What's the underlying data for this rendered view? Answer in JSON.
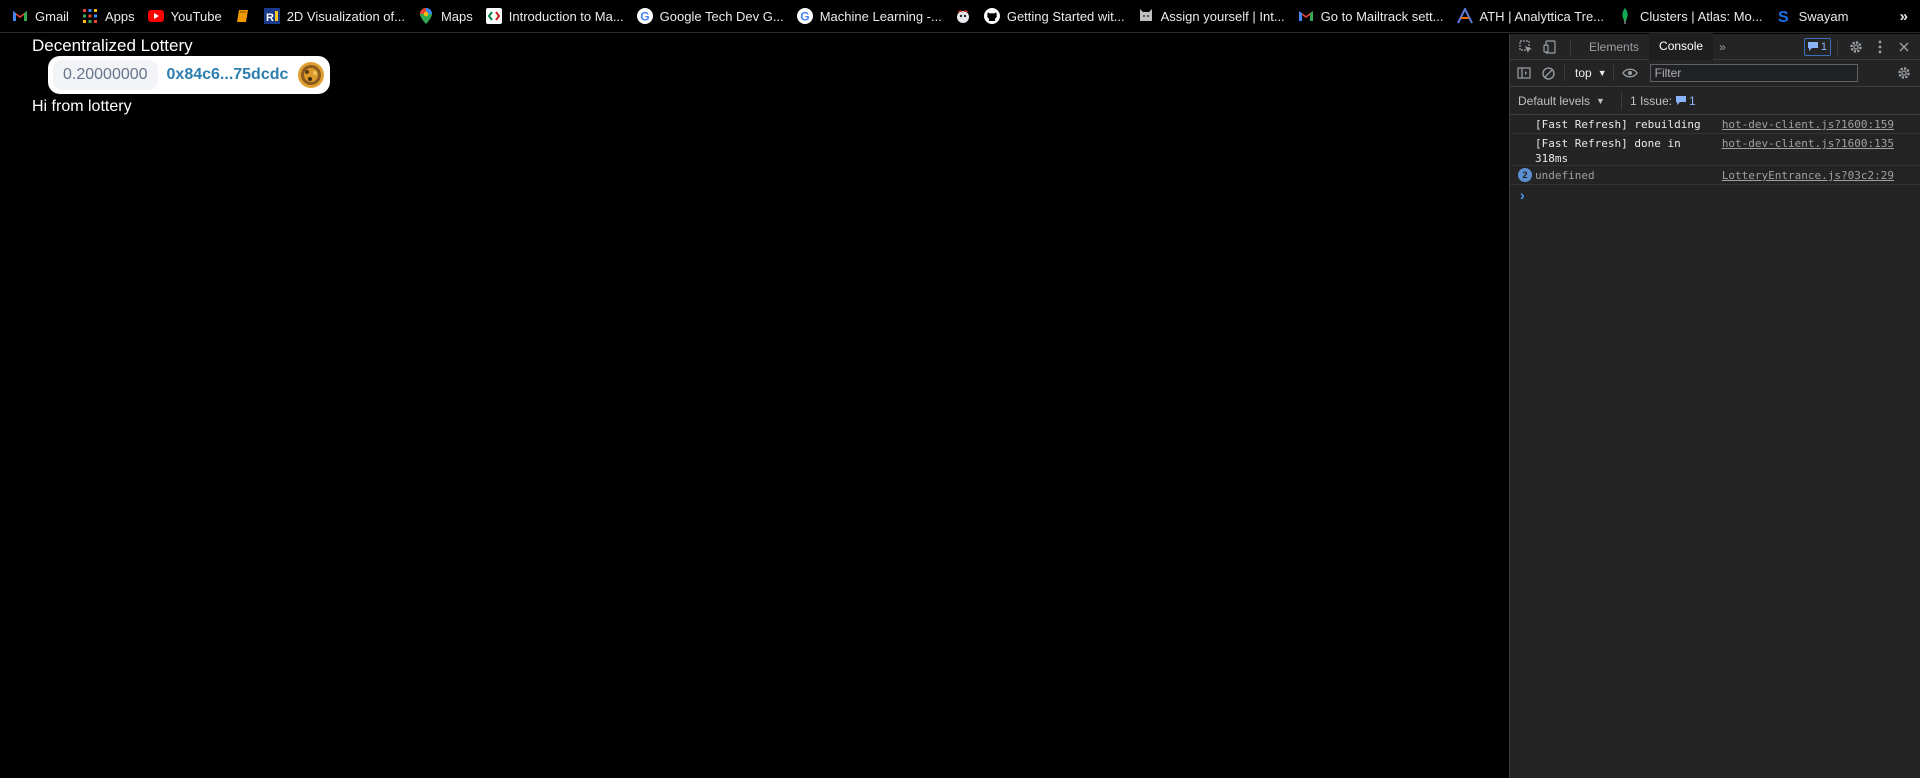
{
  "bookmarks": [
    {
      "label": "Gmail",
      "icon": "gmail-icon"
    },
    {
      "label": "Apps",
      "icon": "apps-grid-icon"
    },
    {
      "label": "YouTube",
      "icon": "youtube-icon"
    },
    {
      "label": "",
      "icon": "book-icon"
    },
    {
      "label": "2D Visualization of...",
      "icon": "ri-icon"
    },
    {
      "label": "Maps",
      "icon": "maps-pin-icon"
    },
    {
      "label": "Introduction to Ma...",
      "icon": "code-icon"
    },
    {
      "label": "Google Tech Dev G...",
      "icon": "google-icon"
    },
    {
      "label": "Machine Learning -...",
      "icon": "google-icon"
    },
    {
      "label": "",
      "icon": "mascot-icon"
    },
    {
      "label": "Getting Started wit...",
      "icon": "github-icon"
    },
    {
      "label": "Assign yourself | Int...",
      "icon": "cat-icon"
    },
    {
      "label": "Go to Mailtrack sett...",
      "icon": "gmail-icon"
    },
    {
      "label": "ATH | Analyttica Tre...",
      "icon": "ath-icon"
    },
    {
      "label": "Clusters | Atlas: Mo...",
      "icon": "mongodb-leaf-icon"
    },
    {
      "label": "Swayam",
      "icon": "swayam-icon"
    }
  ],
  "bookmarks_more": "»",
  "page": {
    "title": "Decentralized Lottery",
    "wallet_balance": "0.20000000",
    "wallet_address": "0x84c6...75dcdc",
    "greeting": "Hi from lottery"
  },
  "devtools": {
    "tabs": [
      "Elements",
      "Console"
    ],
    "active_tab": "Console",
    "more_tabs": "»",
    "issues_badge": "1",
    "context": "top",
    "filter_placeholder": "Filter",
    "levels": "Default levels",
    "issues_label": "1 Issue:",
    "issues_count": "1",
    "messages": [
      {
        "text": "[Fast Refresh] rebuilding",
        "source": "hot-dev-client.js?1600:159",
        "repeat": ""
      },
      {
        "text": "[Fast Refresh] done in 318ms",
        "source": "hot-dev-client.js?1600:135",
        "repeat": ""
      },
      {
        "text": "undefined",
        "source": "LotteryEntrance.js?03c2:29",
        "repeat": "2"
      }
    ],
    "prompt": "›"
  },
  "colors": {
    "wallet_address": "#2e7daf",
    "wallet_balance": "#68738d",
    "devtools_bg": "#242424",
    "accent_blue": "#8ab4f8"
  }
}
